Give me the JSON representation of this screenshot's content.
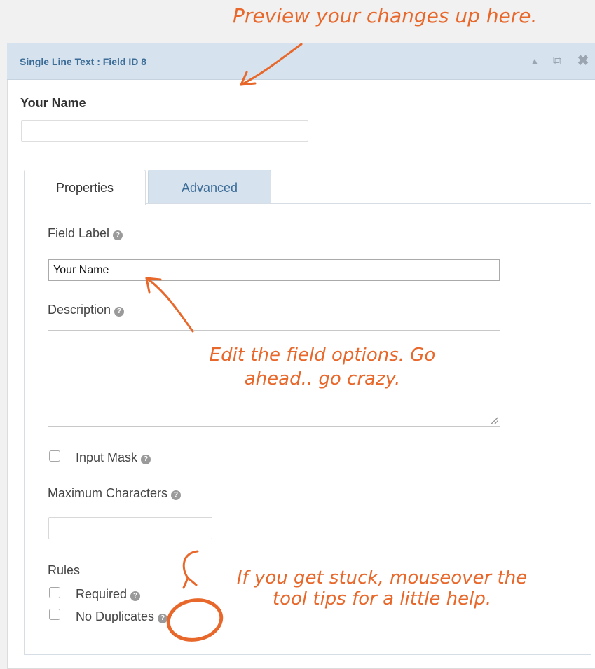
{
  "annotations": {
    "preview": "Preview your changes up here.",
    "edit_line1": "Edit the field options. Go",
    "edit_line2": "ahead.. go crazy.",
    "stuck_line1": "If you get stuck, mouseover the",
    "stuck_line2": "tool tips for a little help."
  },
  "field_header": {
    "title": "Single Line Text : Field ID 8",
    "icons": [
      "collapse-arrow-icon",
      "duplicate-icon",
      "delete-icon"
    ]
  },
  "preview": {
    "label": "Your Name",
    "input_value": ""
  },
  "tabs": [
    {
      "label": "Properties",
      "active": true
    },
    {
      "label": "Advanced",
      "active": false
    }
  ],
  "properties": {
    "field_label": {
      "label": "Field Label",
      "value": "Your Name"
    },
    "description": {
      "label": "Description",
      "value": ""
    },
    "input_mask": {
      "label": "Input Mask",
      "checked": false
    },
    "max_chars": {
      "label": "Maximum Characters",
      "value": ""
    },
    "rules": {
      "label": "Rules",
      "required": {
        "label": "Required",
        "checked": false
      },
      "no_duplicates": {
        "label": "No Duplicates",
        "checked": false
      }
    }
  },
  "colors": {
    "accent_orange": "#e8682b",
    "header_bg": "#d6e3ef",
    "header_text": "#3d6d97"
  }
}
